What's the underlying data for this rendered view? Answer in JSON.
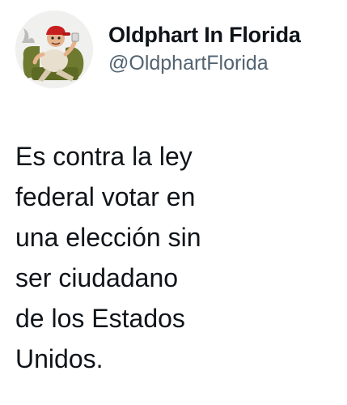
{
  "author": {
    "display_name": "Oldphart In Florida",
    "handle": "@OldphartFlorida",
    "avatar_icon": "cartoon-old-man-avatar-icon"
  },
  "tweet": {
    "lines": [
      "Es contra la ley",
      "federal votar en",
      "una elección sin",
      "ser ciudadano",
      "de los Estados",
      "Unidos."
    ]
  },
  "colors": {
    "text": "#0f1419",
    "secondary_text": "#536471",
    "background": "#ffffff"
  }
}
